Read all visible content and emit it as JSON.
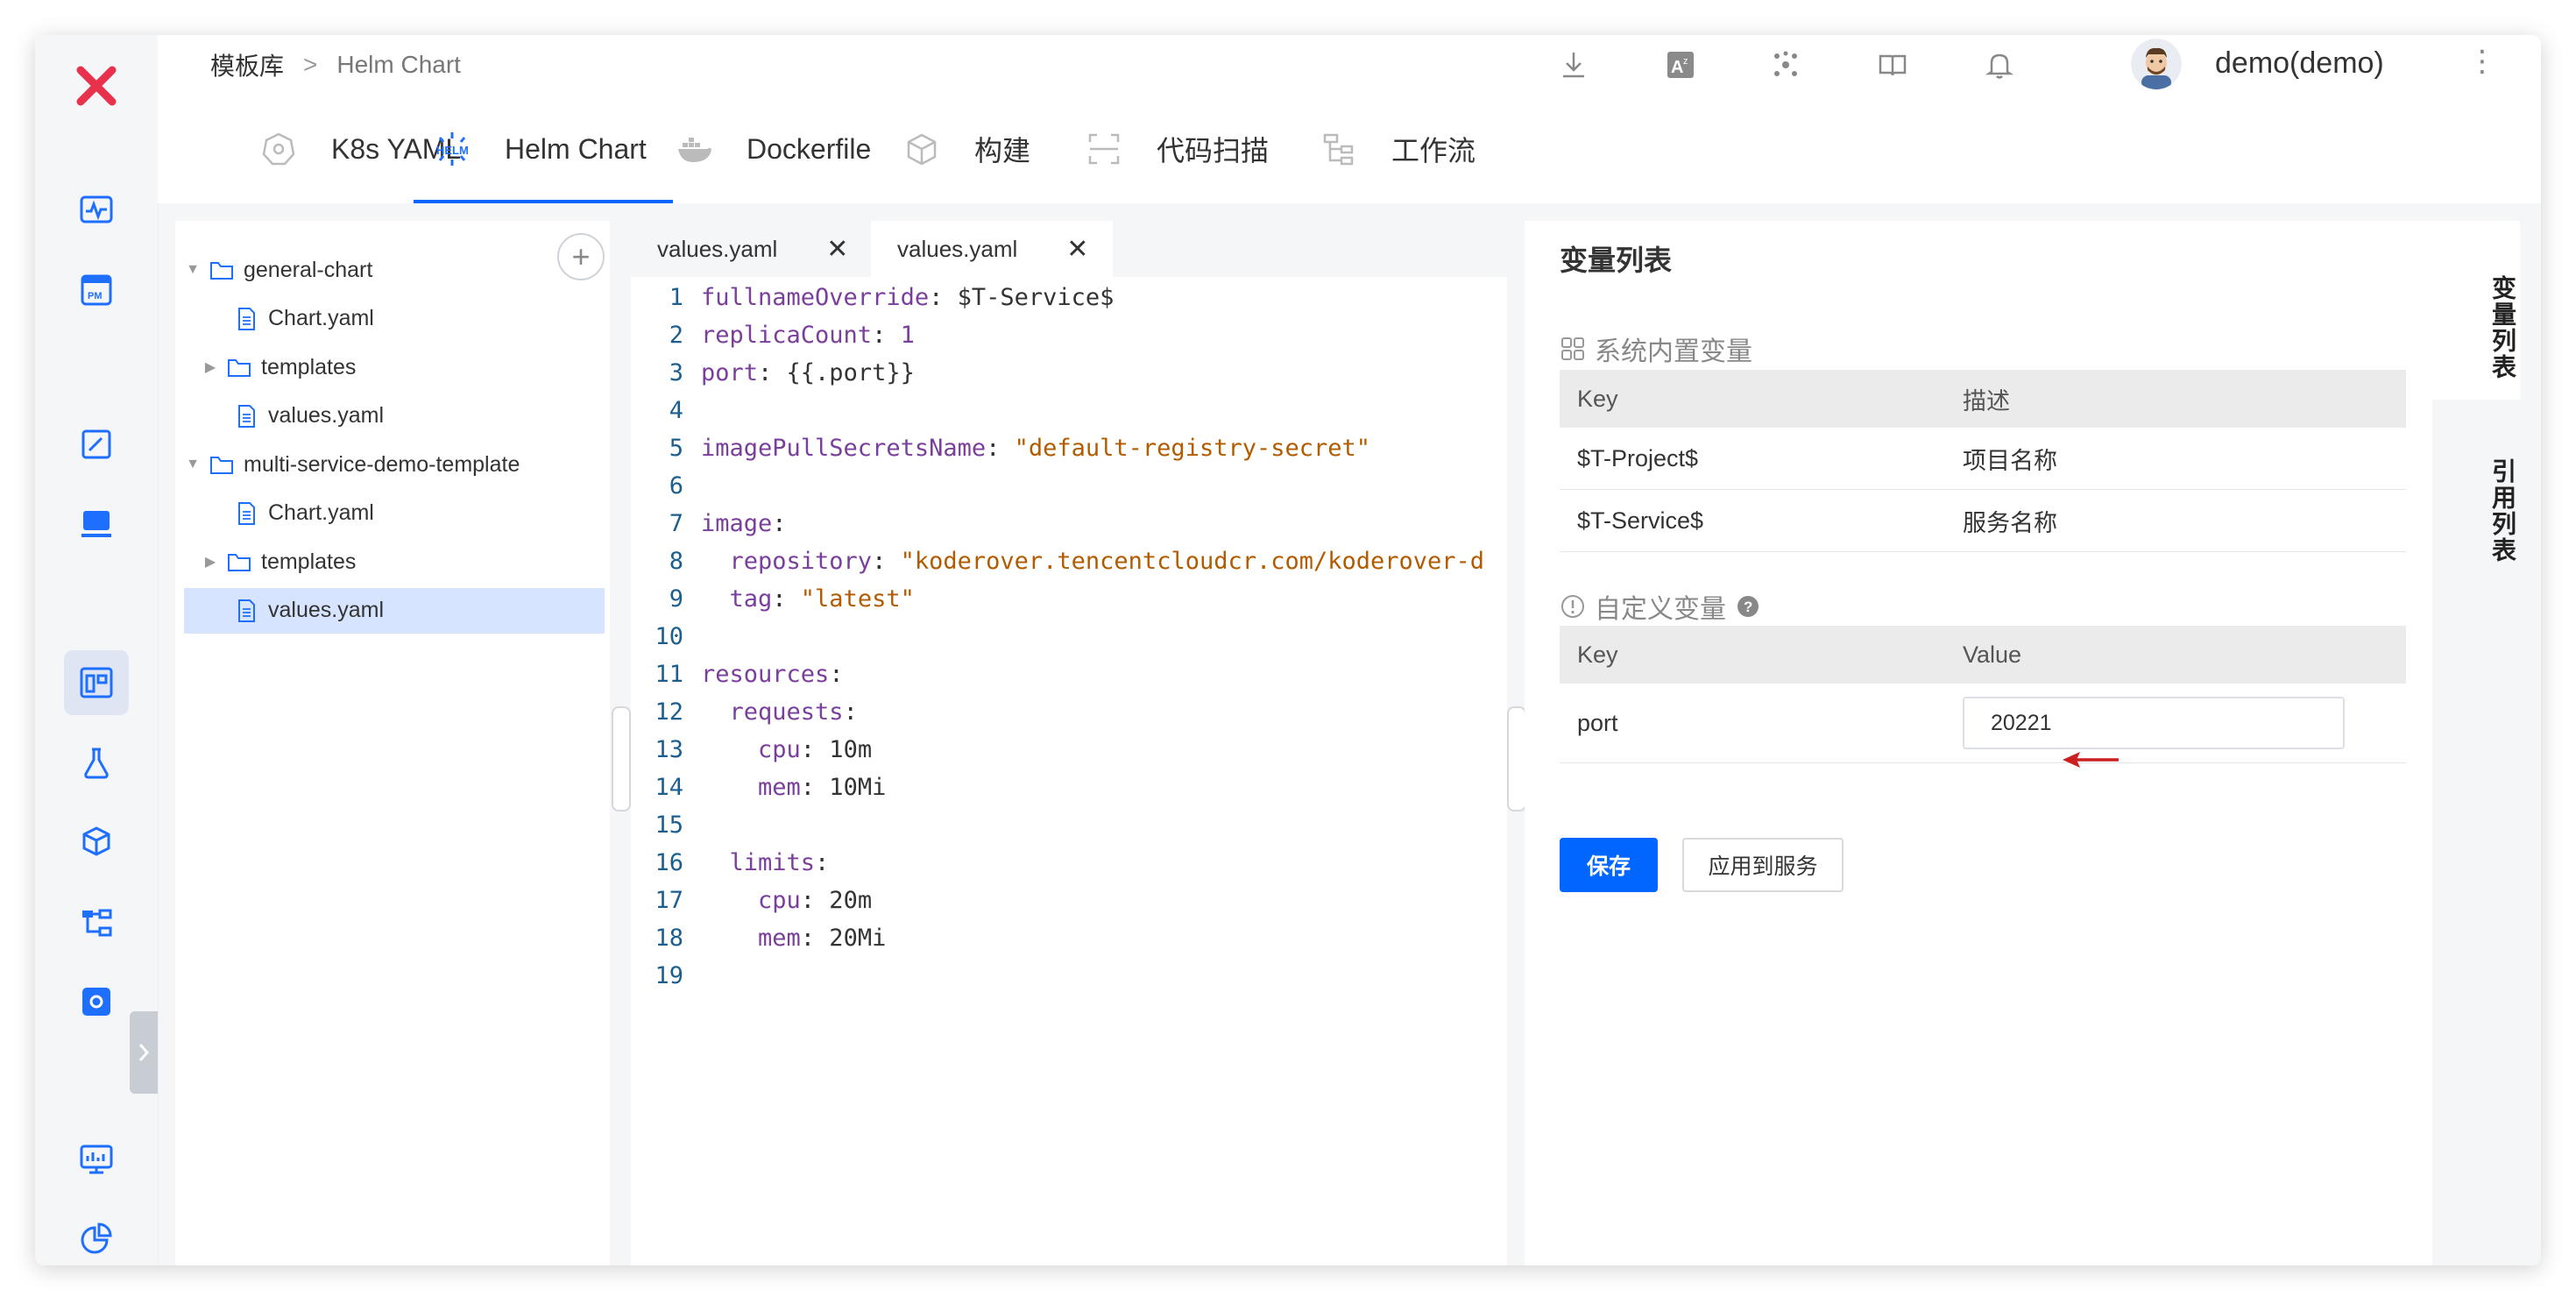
{
  "breadcrumb": {
    "root": "模板库",
    "separator": ">",
    "current": "Helm Chart"
  },
  "user": {
    "name": "demo(demo)"
  },
  "tabs": [
    {
      "label": "K8s YAML",
      "icon": "kubernetes-icon"
    },
    {
      "label": "Helm Chart",
      "icon": "helm-icon",
      "active": true
    },
    {
      "label": "Dockerfile",
      "icon": "docker-icon"
    },
    {
      "label": "构建",
      "icon": "build-cube-icon"
    },
    {
      "label": "代码扫描",
      "icon": "scan-icon"
    },
    {
      "label": "工作流",
      "icon": "workflow-icon"
    }
  ],
  "tree": {
    "items": [
      {
        "label": "general-chart",
        "type": "folder",
        "expanded": true
      },
      {
        "label": "Chart.yaml",
        "type": "file"
      },
      {
        "label": "templates",
        "type": "folder",
        "expanded": false
      },
      {
        "label": "values.yaml",
        "type": "file"
      },
      {
        "label": "multi-service-demo-template",
        "type": "folder",
        "expanded": true
      },
      {
        "label": "Chart.yaml",
        "type": "file"
      },
      {
        "label": "templates",
        "type": "folder",
        "expanded": false
      },
      {
        "label": "values.yaml",
        "type": "file",
        "selected": true
      }
    ],
    "add_label": "+"
  },
  "editor": {
    "tabs": [
      {
        "label": "values.yaml",
        "close": "✕"
      },
      {
        "label": "values.yaml",
        "close": "✕",
        "active": true
      }
    ],
    "line_numbers": [
      "1",
      "2",
      "3",
      "4",
      "5",
      "6",
      "7",
      "8",
      "9",
      "10",
      "11",
      "12",
      "13",
      "14",
      "15",
      "16",
      "17",
      "18",
      "19"
    ],
    "lines": [
      [
        {
          "t": "fullnameOverride",
          "c": "k"
        },
        {
          "t": ": $T-Service$",
          "c": ""
        }
      ],
      [
        {
          "t": "replicaCount",
          "c": "k"
        },
        {
          "t": ": ",
          "c": ""
        },
        {
          "t": "1",
          "c": "n"
        }
      ],
      [
        {
          "t": "port",
          "c": "k"
        },
        {
          "t": ": {{.port}}",
          "c": ""
        }
      ],
      [],
      [
        {
          "t": "imagePullSecretsName",
          "c": "k"
        },
        {
          "t": ": ",
          "c": ""
        },
        {
          "t": "\"default-registry-secret\"",
          "c": "s"
        }
      ],
      [],
      [
        {
          "t": "image",
          "c": "k"
        },
        {
          "t": ":",
          "c": ""
        }
      ],
      [
        {
          "t": "  repository",
          "c": "k"
        },
        {
          "t": ": ",
          "c": ""
        },
        {
          "t": "\"koderover.tencentcloudcr.com/koderover-d",
          "c": "s"
        }
      ],
      [
        {
          "t": "  tag",
          "c": "k"
        },
        {
          "t": ": ",
          "c": ""
        },
        {
          "t": "\"latest\"",
          "c": "s"
        }
      ],
      [],
      [
        {
          "t": "resources",
          "c": "k"
        },
        {
          "t": ":",
          "c": ""
        }
      ],
      [
        {
          "t": "  requests",
          "c": "k"
        },
        {
          "t": ":",
          "c": ""
        }
      ],
      [
        {
          "t": "    cpu",
          "c": "k"
        },
        {
          "t": ": 10m",
          "c": ""
        }
      ],
      [
        {
          "t": "    mem",
          "c": "k"
        },
        {
          "t": ": 10Mi",
          "c": ""
        }
      ],
      [],
      [
        {
          "t": "  limits",
          "c": "k"
        },
        {
          "t": ":",
          "c": ""
        }
      ],
      [
        {
          "t": "    cpu",
          "c": "k"
        },
        {
          "t": ": 20m",
          "c": ""
        }
      ],
      [
        {
          "t": "    mem",
          "c": "k"
        },
        {
          "t": ": 20Mi",
          "c": ""
        }
      ],
      []
    ]
  },
  "vars": {
    "title": "变量列表",
    "system": {
      "title": "系统内置变量",
      "headers": [
        "Key",
        "描述"
      ],
      "rows": [
        [
          "$T-Project$",
          "项目名称"
        ],
        [
          "$T-Service$",
          "服务名称"
        ]
      ]
    },
    "custom": {
      "title": "自定义变量",
      "headers": [
        "Key",
        "Value"
      ],
      "rows": [
        {
          "key": "port",
          "value": "20221"
        }
      ]
    },
    "save_label": "保存",
    "apply_label": "应用到服务"
  },
  "rail": {
    "variables_label": "变量列表",
    "references_label": "引用列表"
  },
  "colors": {
    "accent": "#0066ff",
    "logo": "#e8314c",
    "annotation_arrow": "#cc1f1f"
  }
}
